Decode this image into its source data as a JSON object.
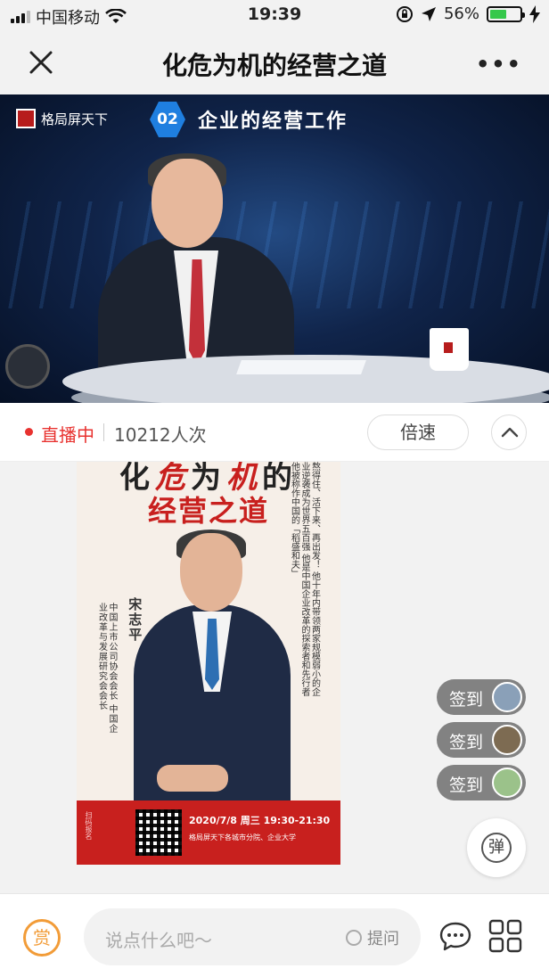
{
  "status_bar": {
    "carrier": "中国移动",
    "time": "19:39",
    "battery_percent": "56%",
    "battery_level": 0.56,
    "icons": [
      "signal-icon",
      "wifi-icon",
      "lock-rotation-icon",
      "location-icon",
      "battery-icon",
      "charging-icon"
    ]
  },
  "nav": {
    "title": "化危为机的经营之道",
    "close_icon": "close-icon",
    "more_icon": "more-icon"
  },
  "video": {
    "logo_text": "格局屏天下",
    "episode_number": "02",
    "episode_title": "企业的经营工作"
  },
  "live_bar": {
    "status": "直播中",
    "viewers": "10212人次",
    "speed_button": "倍速"
  },
  "poster": {
    "title_line1_black1": "化",
    "title_line1_red1": "危",
    "title_line1_black2": "为",
    "title_line1_red2": "机",
    "title_line1_black3": "的",
    "title_line2": "经营之道",
    "name": "宋志平",
    "roles": "中国上市公司协会会长 中国企业改革与发展研究会会长",
    "side_text": "熬得住、活下来、再出发！ 他十年内带领两家规模弱小的企业逆袭成为世界五百强 他是中国企业改革的探索者和先行者 他被称作中国的「稻盛和夫」",
    "date": "2020/7/8 周三 19:30-21:30",
    "location": "格局屏天下各城市分院、企业大学",
    "qr_label": "扫码报名"
  },
  "checkins": [
    {
      "label": "签到"
    },
    {
      "label": "签到"
    },
    {
      "label": "签到"
    }
  ],
  "danmu_label": "弹",
  "bottom": {
    "reward_label": "赏",
    "comment_placeholder": "说点什么吧～",
    "ask_label": "提问"
  },
  "colors": {
    "live_red": "#e8322f",
    "reward_orange": "#f29c38",
    "poster_red": "#c8201e",
    "battery_green": "#35c84b"
  }
}
